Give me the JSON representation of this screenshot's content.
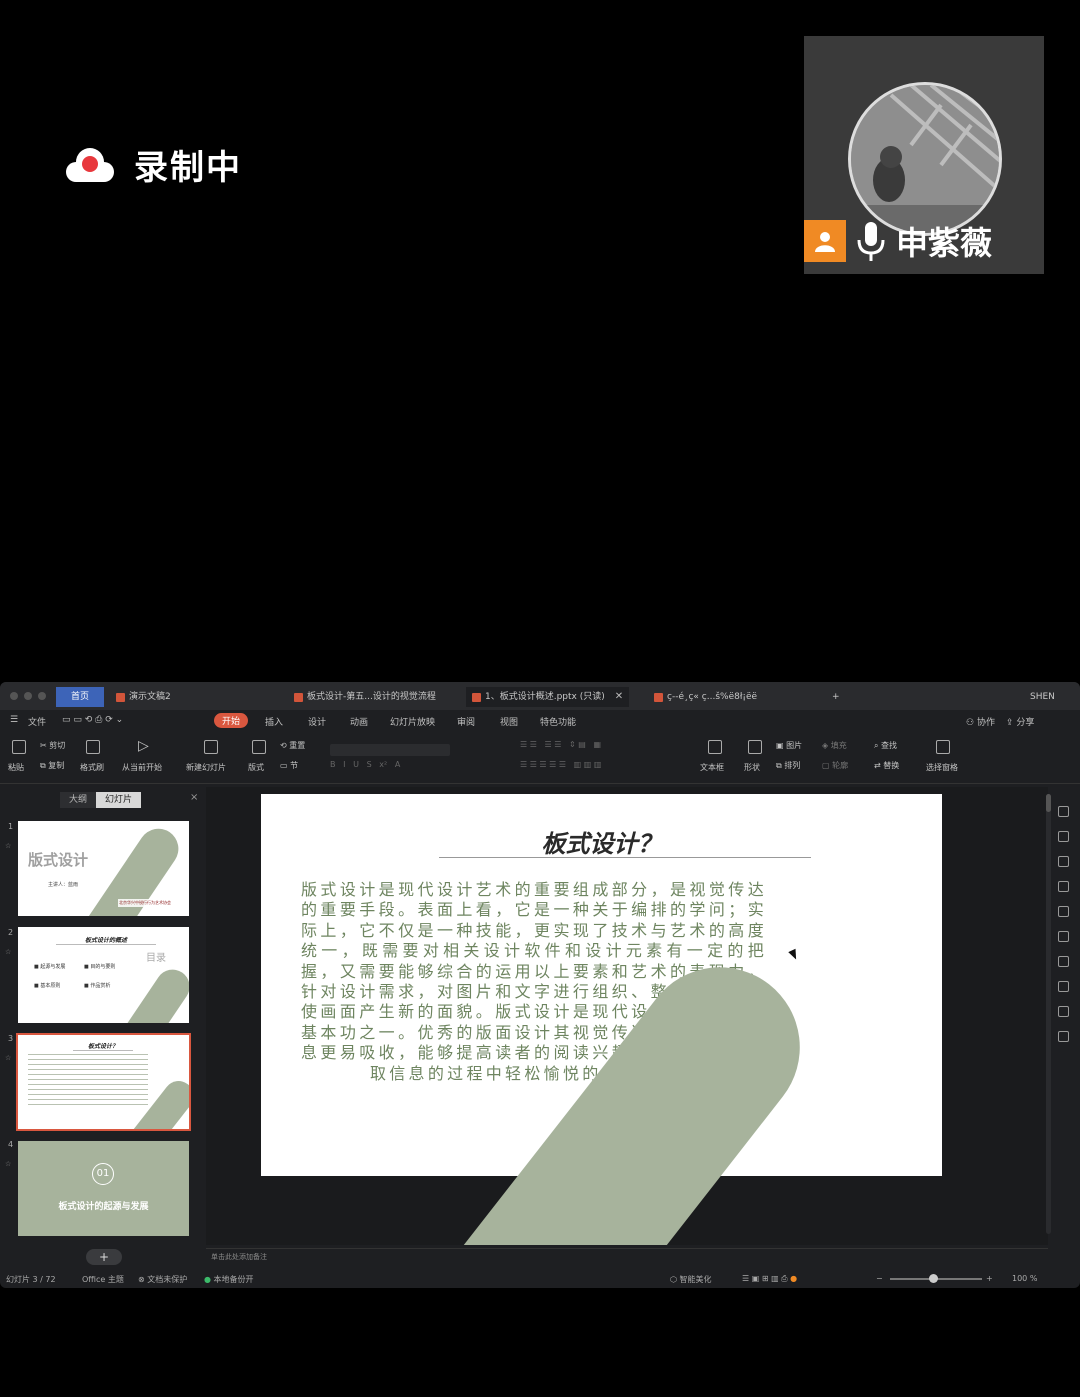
{
  "recording": {
    "label": "录制中"
  },
  "participant": {
    "name": "申紫薇"
  },
  "app": {
    "tabs": [
      {
        "label": "首页"
      },
      {
        "label": "演示文稿2"
      },
      {
        "label": "板式设计-第五...设计的视觉流程"
      },
      {
        "label": "1、板式设计概述.pptx (只读)"
      },
      {
        "label": "ç--é¸ç«  ç...š%ë8ł¡ëë"
      }
    ],
    "user_badge": "SHEN",
    "menu": [
      "文件",
      "开始",
      "插入",
      "设计",
      "动画",
      "幻灯片放映",
      "审阅",
      "视图",
      "特色功能"
    ],
    "menu_active": "开始",
    "menu_right": [
      "协作",
      "分享"
    ],
    "ribbon": {
      "paste": "粘贴",
      "cut": "剪切",
      "copy": "复制",
      "format_painter": "格式刷",
      "play_from_current": "从当前开始",
      "new_slide": "新建幻灯片",
      "layout": "版式",
      "reset": "重置",
      "section": "节",
      "textbox": "文本框",
      "shape": "形状",
      "picture": "图片",
      "fill": "填充",
      "arrange": "排列",
      "outline": "轮廓",
      "find": "查找",
      "replace": "替换",
      "select_pane": "选择窗格"
    },
    "panel_tabs": [
      "大纲",
      "幻灯片"
    ],
    "thumbs": [
      {
        "num": "1",
        "title": "版式设计",
        "sub": "主讲人：蓝雨",
        "logo": "北京华兴中锐行行为艺术协会"
      },
      {
        "num": "2",
        "title": "板式设计的概述",
        "toc": "目录",
        "items": [
          "起源与发展",
          "目的与要则",
          "基本原则",
          "作品赏析"
        ]
      },
      {
        "num": "3",
        "title": "板式设计？"
      },
      {
        "num": "4",
        "badge": "01",
        "title": "板式设计的起源与发展"
      }
    ],
    "slide": {
      "title": "板式设计？",
      "body": "版式设计是现代设计艺术的重要组成部分，是视觉传达的重要手段。表面上看，它是一种关于编排的学问；实际上，它不仅是一种技能，更实现了技术与艺术的高度统一，既需要对相关设计软件和设计元素有一定的把握，又需要能够综合的运用以上要素和艺术的表现力，针对设计需求，对图片和文字进行组织、整合、版式，使画面产生新的面貌。版式设计是现代设计者所必备的基本功之一。优秀的版面设计其视觉传达效果更佳，信息更易吸收，能够提高读者的阅读兴趣，帮助读者在获取信息的过程中轻松愉悦的了解内容。"
    },
    "notes_placeholder": "单击此处添加备注",
    "status": {
      "slide_count": "幻灯片 3 / 72",
      "theme": "Office 主题",
      "protect": "文档未保护",
      "backup": "本地备份开",
      "beautify": "智能美化",
      "zoom": "100 %"
    },
    "colors": {
      "accent": "#d9573f",
      "home_tab": "#3d64b8",
      "shape": "#a7b39c",
      "body_text": "#6e8560"
    }
  }
}
